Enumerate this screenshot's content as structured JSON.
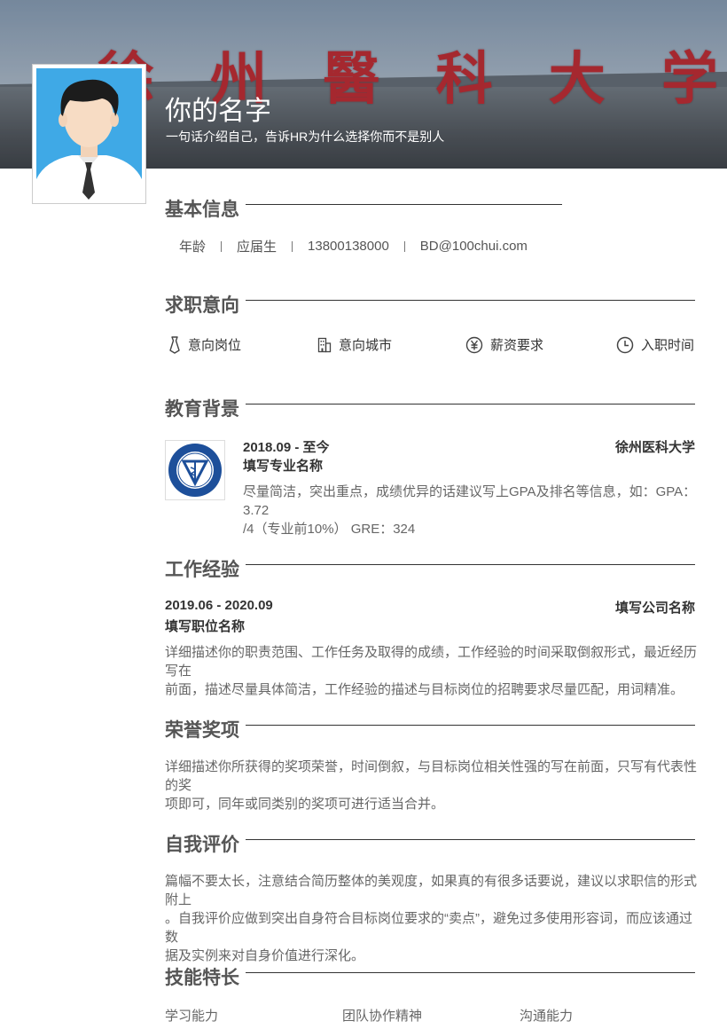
{
  "header": {
    "banner_sign": [
      "徐",
      "州",
      "醫",
      "科",
      "大",
      "学"
    ],
    "name": "你的名字",
    "tagline": "一句话介绍自己，告诉HR为什么选择你而不是别人"
  },
  "sections": {
    "basic": {
      "title": "基本信息",
      "items": [
        "年龄",
        "应届生",
        "13800138000",
        "BD@100chui.com"
      ]
    },
    "intent": {
      "title": "求职意向",
      "items": [
        {
          "icon": "tie-icon",
          "label": "意向岗位"
        },
        {
          "icon": "building-icon",
          "label": "意向城市"
        },
        {
          "icon": "yuan-icon",
          "label": "薪资要求"
        },
        {
          "icon": "clock-icon",
          "label": "入职时间"
        }
      ]
    },
    "education": {
      "title": "教育背景",
      "date": "2018.09 - 至今",
      "school": "徐州医科大学",
      "major": "填写专业名称",
      "description": [
        "尽量简洁，突出重点，成绩优异的话建议写上GPA及排名等信息，如：GPA：3.72",
        "/4（专业前10%） GRE：324"
      ]
    },
    "work": {
      "title": "工作经验",
      "date": "2019.06 - 2020.09",
      "company": "填写公司名称",
      "position": "填写职位名称",
      "description": [
        "详细描述你的职责范围、工作任务及取得的成绩，工作经验的时间采取倒叙形式，最近经历写在",
        "前面，描述尽量具体简洁，工作经验的描述与目标岗位的招聘要求尽量匹配，用词精准。"
      ]
    },
    "honors": {
      "title": "荣誉奖项",
      "description": [
        "详细描述你所获得的奖项荣誉，时间倒叙，与目标岗位相关性强的写在前面，只写有代表性的奖",
        "项即可，同年或同类别的奖项可进行适当合并。"
      ]
    },
    "self": {
      "title": "自我评价",
      "description": [
        "篇幅不要太长，注意结合简历整体的美观度，如果真的有很多话要说，建议以求职信的形式附上",
        "。自我评价应做到突出自身符合目标岗位要求的“卖点”，避免过多使用形容词，而应该通过数",
        "据及实例来对自身价值进行深化。"
      ]
    },
    "skills": {
      "title": "技能特长",
      "items": [
        "学习能力",
        "团队协作精神",
        "沟通能力"
      ]
    }
  },
  "colors": {
    "banner_sign": "#b8242a",
    "photo_bg": "#3fa9e6",
    "text_dark": "#333333",
    "text_body": "#666666"
  }
}
